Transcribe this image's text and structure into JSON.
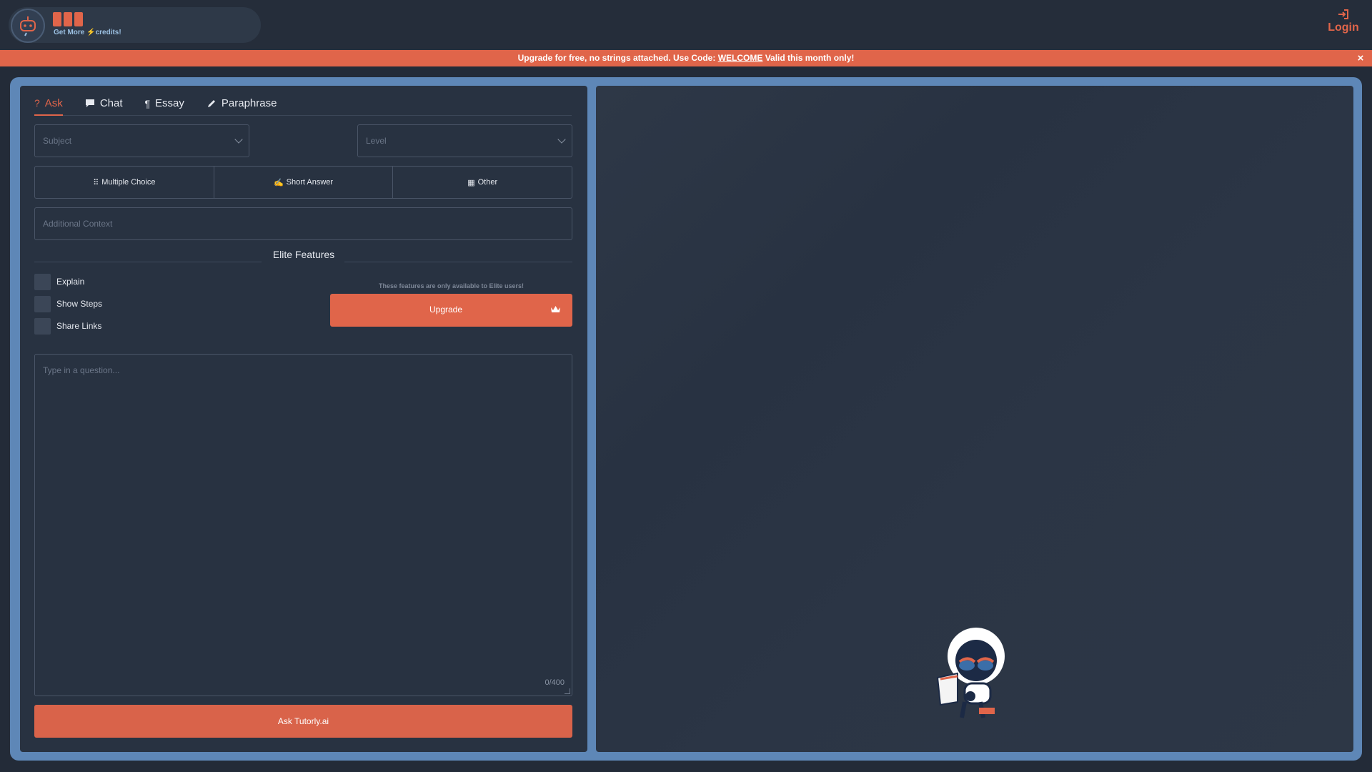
{
  "header": {
    "credits_link": "Get More",
    "credits_suffix": "credits!",
    "login_label": "Login"
  },
  "banner": {
    "text_before": "Upgrade for free, no strings attached. Use Code:",
    "code": "WELCOME",
    "text_after": "Valid this month only!",
    "close": "×"
  },
  "tabs": [
    {
      "label": "Ask",
      "icon": "question-icon",
      "active": true
    },
    {
      "label": "Chat",
      "icon": "chat-bubble-icon",
      "active": false
    },
    {
      "label": "Essay",
      "icon": "paragraph-icon",
      "active": false
    },
    {
      "label": "Paraphrase",
      "icon": "pencil-icon",
      "active": false
    }
  ],
  "form": {
    "subject_placeholder": "Subject",
    "level_placeholder": "Level",
    "answer_types": [
      {
        "label": "Multiple Choice",
        "icon": "grid-icon"
      },
      {
        "label": "Short Answer",
        "icon": "signature-icon"
      },
      {
        "label": "Other",
        "icon": "dots-grid-icon"
      }
    ],
    "context_placeholder": "Additional Context",
    "question_placeholder": "Type in a question...",
    "char_count": "0/400",
    "ask_button": "Ask Tutorly.ai"
  },
  "elite": {
    "title": "Elite Features",
    "options": [
      "Explain",
      "Show Steps",
      "Share Links"
    ],
    "note": "These features are only available to Elite users!",
    "upgrade_button": "Upgrade"
  },
  "colors": {
    "accent": "#e0654a",
    "background": "#232b38",
    "panel": "#283241",
    "frame": "#5e87b7"
  }
}
